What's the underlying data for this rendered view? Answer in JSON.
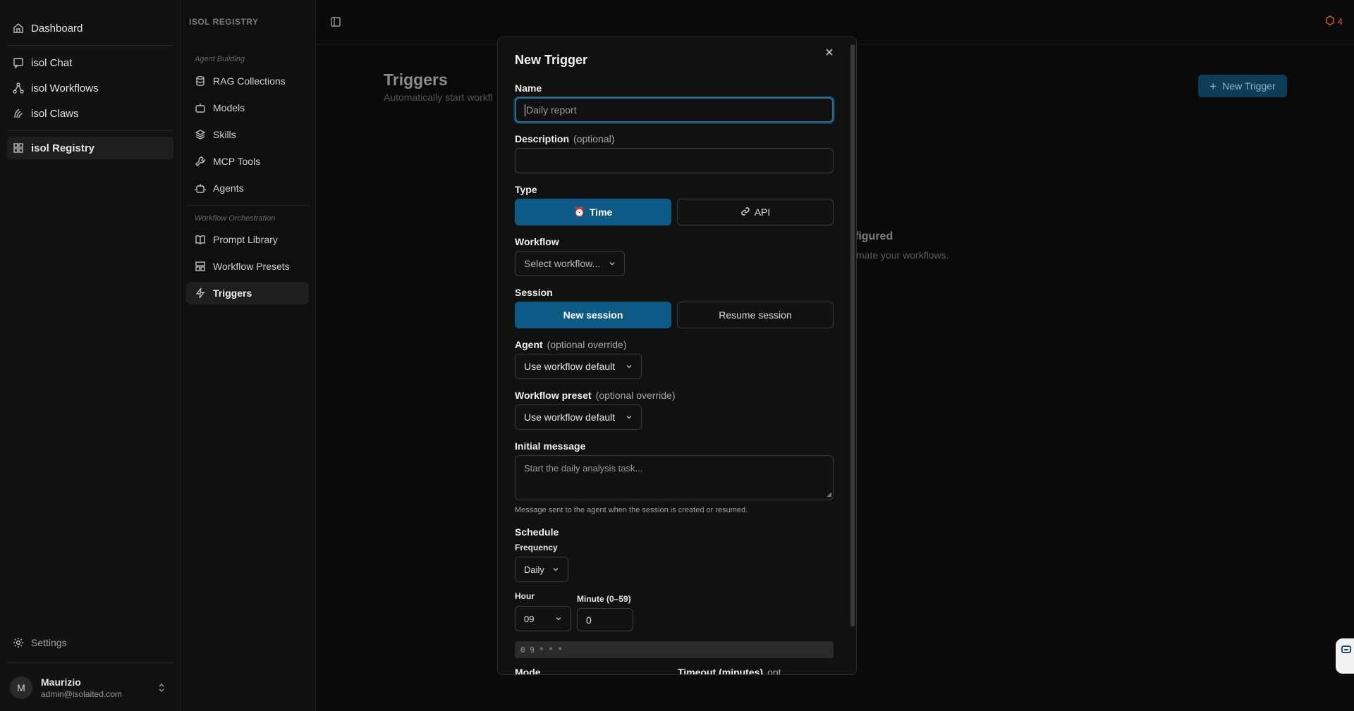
{
  "sidebar": {
    "items": [
      {
        "label": "Dashboard",
        "icon": "home-icon"
      },
      {
        "label": "isol Chat",
        "icon": "message-icon"
      },
      {
        "label": "isol Workflows",
        "icon": "workflow-icon"
      },
      {
        "label": "isol Claws",
        "icon": "claw-icon"
      },
      {
        "label": "isol Registry",
        "icon": "grid-icon"
      }
    ],
    "settings_label": "Settings",
    "user": {
      "initial": "M",
      "name": "Maurizio",
      "email": "admin@isolaited.com"
    }
  },
  "registry": {
    "title": "ISOL REGISTRY",
    "group1": "Agent Building",
    "group1_items": [
      "RAG Collections",
      "Models",
      "Skills",
      "MCP Tools",
      "Agents"
    ],
    "group2": "Workflow Orchestration",
    "group2_items": [
      "Prompt Library",
      "Workflow Presets",
      "Triggers"
    ]
  },
  "header": {
    "notification_count": "4"
  },
  "page": {
    "title": "Triggers",
    "subtitle": "Automatically start workfl",
    "new_button": "New Trigger",
    "empty_title": "figured",
    "empty_sub": "mate your workflows."
  },
  "modal": {
    "title": "New Trigger",
    "name_label": "Name",
    "name_placeholder": "Daily report",
    "description_label": "Description",
    "optional": "(optional)",
    "type_label": "Type",
    "type_time": "Time",
    "type_api": "API",
    "workflow_label": "Workflow",
    "workflow_placeholder": "Select workflow...",
    "session_label": "Session",
    "session_new": "New session",
    "session_resume": "Resume session",
    "agent_label": "Agent",
    "optional_override": "(optional override)",
    "agent_value": "Use workflow default",
    "preset_label": "Workflow preset",
    "preset_value": "Use workflow default",
    "message_label": "Initial message",
    "message_placeholder": "Start the daily analysis task...",
    "message_help": "Message sent to the agent when the session is created or resumed.",
    "schedule_label": "Schedule",
    "frequency_label": "Frequency",
    "frequency_value": "Daily",
    "hour_label": "Hour",
    "hour_value": "09",
    "minute_label": "Minute (0–59)",
    "minute_value": "0",
    "cron": "0 9 * * *",
    "mode_label": "Mode",
    "timeout_label": "Timeout (minutes)",
    "timeout_opt": "opt"
  }
}
